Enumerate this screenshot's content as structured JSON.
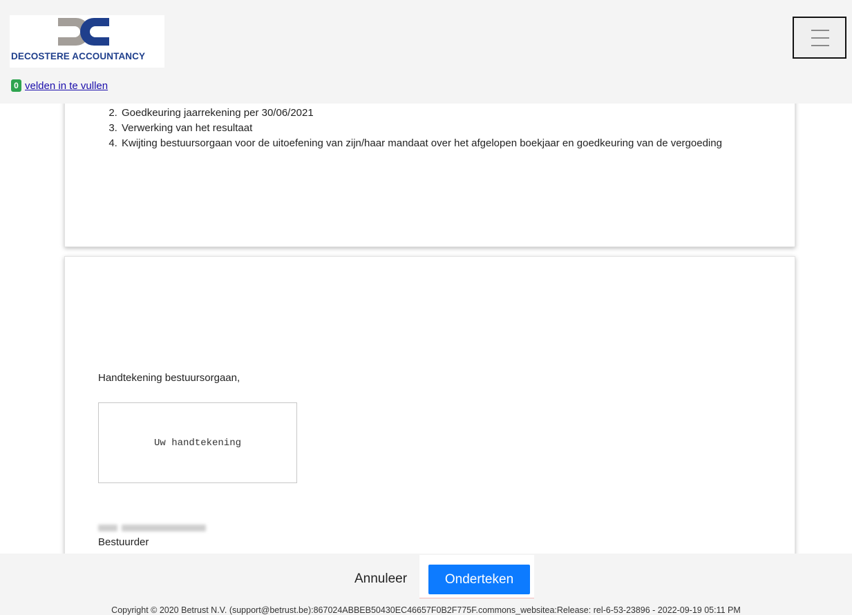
{
  "header": {
    "logo_text": "DECOSTERE ACCOUNTANCY",
    "menu_icon": "hamburger-icon",
    "fields": {
      "count": "0",
      "link_text": "velden in te vullen"
    }
  },
  "document": {
    "agenda_items": [
      "Goedkeuring jaarrekening per 30/06/2021",
      "Verwerking van het resultaat",
      "Kwijting bestuursorgaan voor de uitoefening van zijn/haar mandaat over het afgelopen boekjaar en goedkeuring van de vergoeding"
    ],
    "signature_label": "Handtekening bestuursorgaan,",
    "signature_placeholder": "Uw handtekening",
    "signer_role": "Bestuurder"
  },
  "footer": {
    "cancel_label": "Annuleer",
    "sign_label": "Onderteken",
    "copyright": "Copyright © 2020 Betrust N.V. (support@betrust.be):867024ABBEB50430EC46657F0B2F775F.commons_websitea:Release: rel-6-53-23896 - 2022-09-19 05:11 PM"
  },
  "colors": {
    "primary_button": "#0d7bff",
    "badge": "#2ea44f",
    "logo_blue": "#1f3f8c",
    "logo_grey": "#a39e99"
  }
}
